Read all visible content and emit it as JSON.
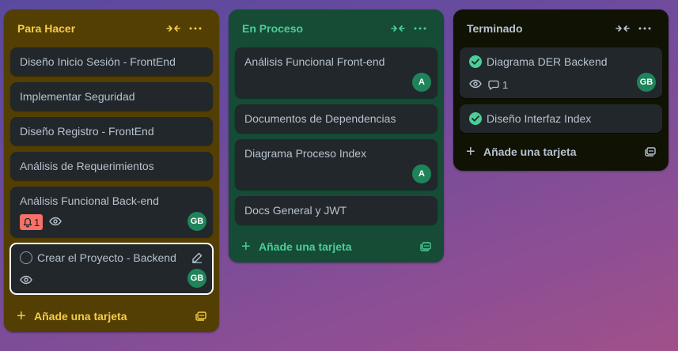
{
  "lists": [
    {
      "title": "Para Hacer",
      "add_label": "Añade una tarjeta",
      "colors": {
        "bg": "#533f04",
        "title": "#f5cd47"
      },
      "cards": [
        {
          "title": "Diseño Inicio Sesión - FrontEnd"
        },
        {
          "title": "Implementar Seguridad"
        },
        {
          "title": "Diseño Registro - FrontEnd"
        },
        {
          "title": "Análisis de Requerimientos"
        },
        {
          "title": "Análisis Funcional Back-end",
          "notification_count": "1",
          "watching": true,
          "member": "GB"
        },
        {
          "title": "Crear el Proyecto - Backend",
          "watching": true,
          "member": "GB",
          "selected": true
        }
      ]
    },
    {
      "title": "En Proceso",
      "add_label": "Añade una tarjeta",
      "colors": {
        "bg": "#164b35",
        "title": "#4bce97"
      },
      "cards": [
        {
          "title": "Análisis Funcional Front-end",
          "member": "A"
        },
        {
          "title": "Documentos de Dependencias"
        },
        {
          "title": "Diagrama Proceso Index",
          "member": "A"
        },
        {
          "title": "Docs General y JWT"
        }
      ]
    },
    {
      "title": "Terminado",
      "add_label": "Añade una tarjeta",
      "colors": {
        "bg": "#101204",
        "title": "#b6c2cf"
      },
      "cards": [
        {
          "title": "Diagrama DER Backend",
          "done": true,
          "watching": true,
          "comment_count": "1",
          "member": "GB"
        },
        {
          "title": "Diseño Interfaz Index",
          "done": true
        }
      ]
    }
  ]
}
